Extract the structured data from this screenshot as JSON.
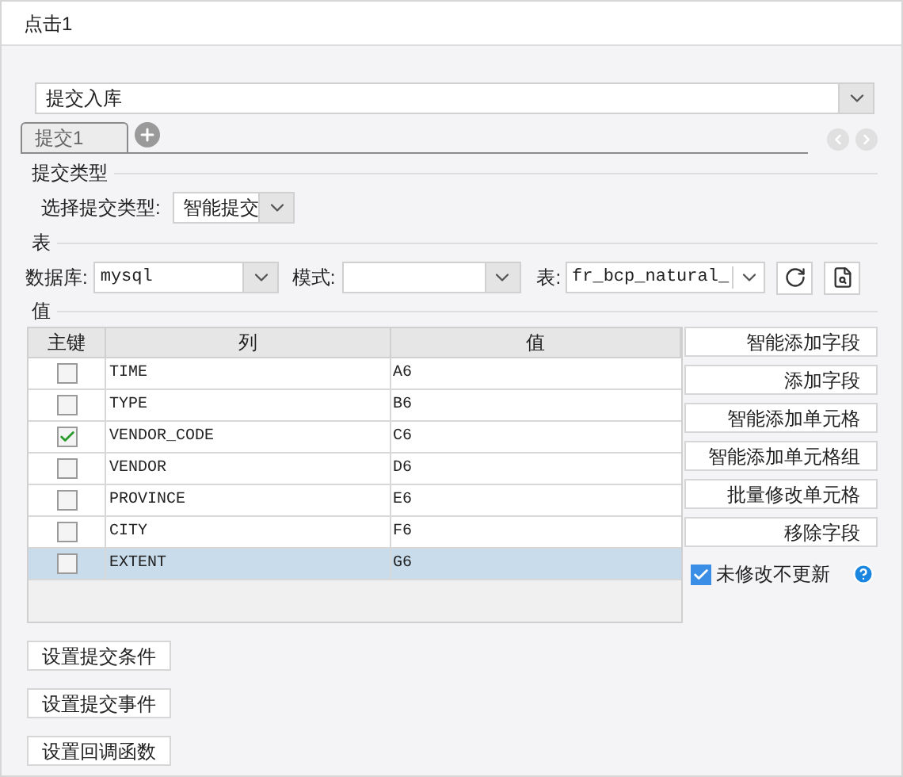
{
  "window": {
    "title": "点击1"
  },
  "action_select": {
    "value": "提交入库"
  },
  "tabs": [
    {
      "label": "提交1",
      "selected": true
    }
  ],
  "submit_type": {
    "heading": "提交类型",
    "label": "选择提交类型:",
    "value": "智能提交"
  },
  "table_source": {
    "heading": "表",
    "database_label": "数据库:",
    "database": "mysql",
    "schema_label": "模式:",
    "table_label": "表:",
    "table": "fr_bcp_natural_"
  },
  "values": {
    "heading": "值",
    "columns": [
      "主键",
      "列",
      "值"
    ],
    "rows": [
      {
        "key": false,
        "column": "TIME",
        "value": "A6",
        "selected": false
      },
      {
        "key": false,
        "column": "TYPE",
        "value": "B6",
        "selected": false
      },
      {
        "key": true,
        "column": "VENDOR_CODE",
        "value": "C6",
        "selected": false
      },
      {
        "key": false,
        "column": "VENDOR",
        "value": "D6",
        "selected": false
      },
      {
        "key": false,
        "column": "PROVINCE",
        "value": "E6",
        "selected": false
      },
      {
        "key": false,
        "column": "CITY",
        "value": "F6",
        "selected": false
      },
      {
        "key": false,
        "column": "EXTENT",
        "value": "G6",
        "selected": true
      }
    ],
    "side_buttons": [
      "智能添加字段",
      "添加字段",
      "智能添加单元格",
      "智能添加单元格组",
      "批量修改单元格",
      "移除字段"
    ],
    "skip_unchanged": {
      "label": "未修改不更新",
      "checked": true
    }
  },
  "bottom_buttons": [
    "设置提交条件",
    "设置提交事件",
    "设置回调函数"
  ]
}
